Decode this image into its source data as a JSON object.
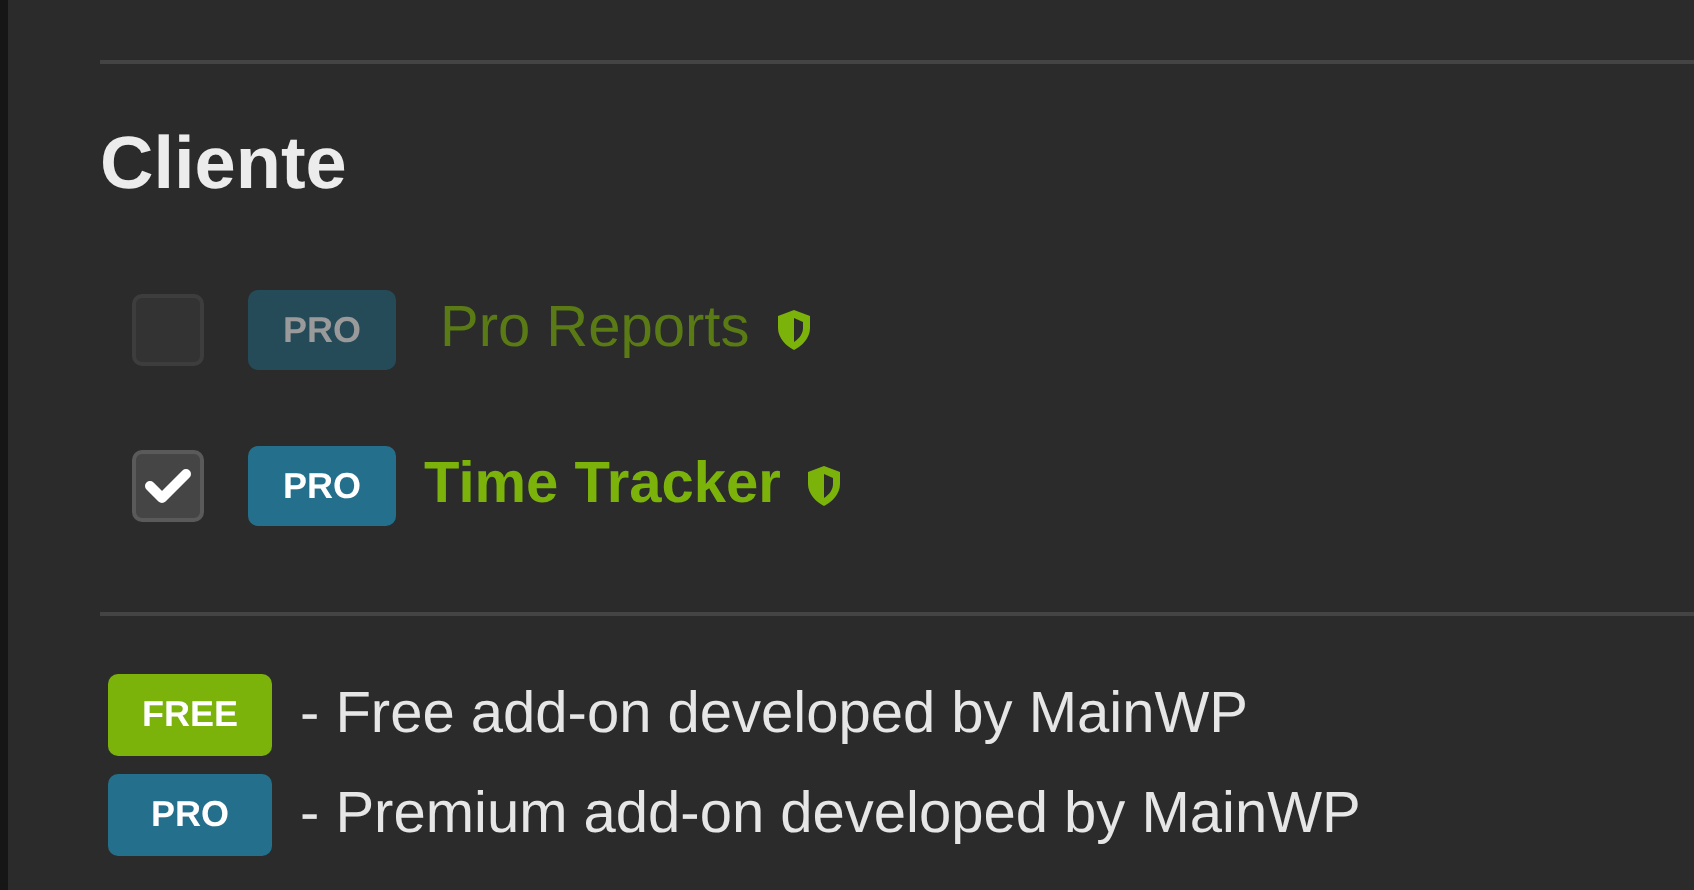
{
  "section": {
    "title": "Cliente"
  },
  "addons": [
    {
      "badge": "PRO",
      "name": "Pro Reports",
      "checked": false,
      "disabled": true
    },
    {
      "badge": "PRO",
      "name": "Time Tracker",
      "checked": true,
      "disabled": false
    }
  ],
  "legend": [
    {
      "kind": "free",
      "badge": "FREE",
      "text": "- Free add-on developed by MainWP"
    },
    {
      "kind": "pro",
      "badge": "PRO",
      "text": "- Premium add-on developed by MainWP"
    }
  ]
}
